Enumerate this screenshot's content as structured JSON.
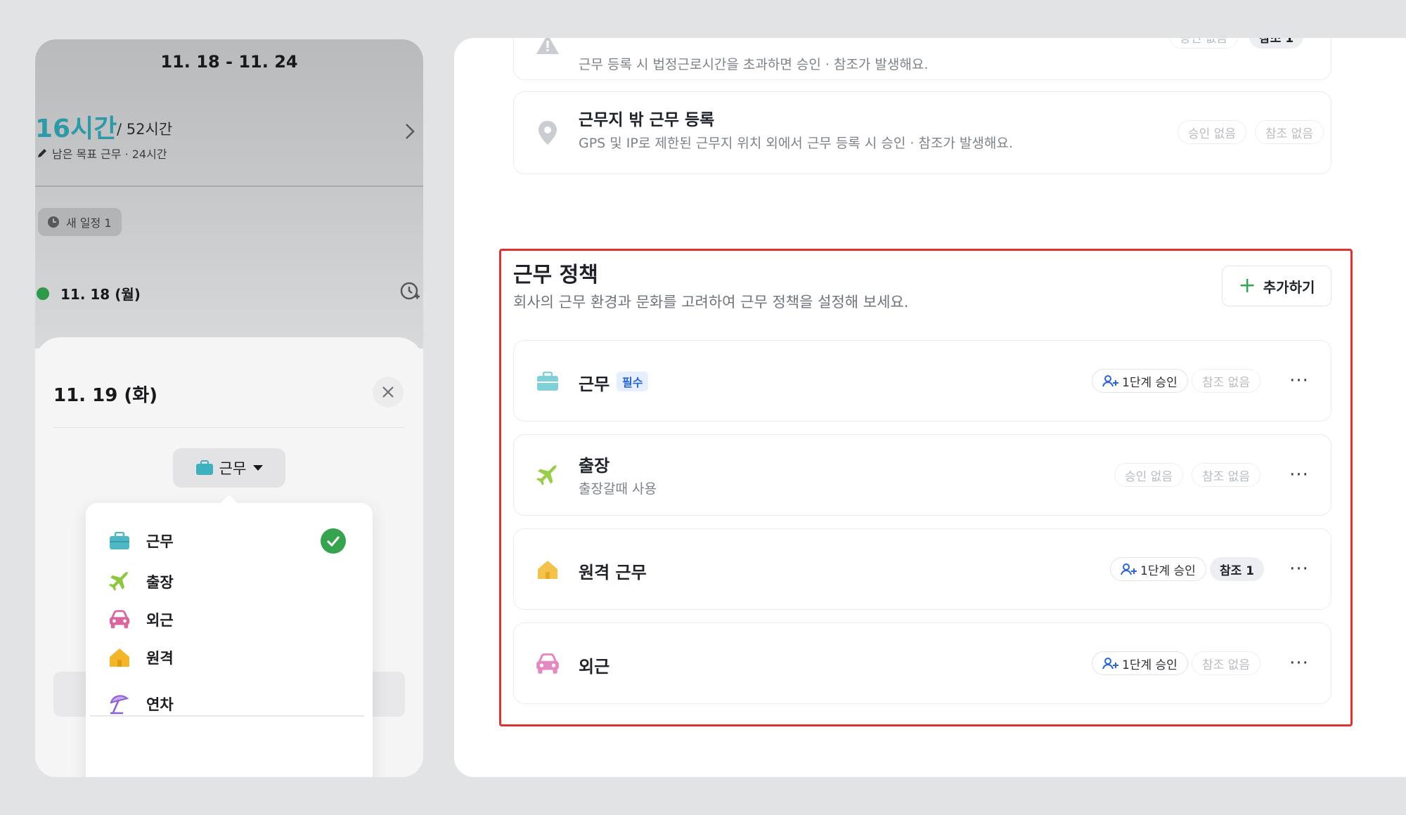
{
  "phone": {
    "week_range": "11. 18 - 11. 24",
    "hours_worked": "16시간",
    "hours_total": "/ 52시간",
    "goal_text": "남은 목표 근무 · 24시간",
    "new_schedule": "새 일정 1",
    "day_label": "11. 18 (월)",
    "sheet": {
      "title": "11. 19 (화)",
      "type_button": "근무",
      "options": [
        {
          "label": "근무",
          "icon": "briefcase-icon",
          "color": "#4fb7c4",
          "selected": true
        },
        {
          "label": "출장",
          "icon": "airplane-icon",
          "color": "#8dc63f"
        },
        {
          "label": "외근",
          "icon": "car-icon",
          "color": "#d9669f"
        },
        {
          "label": "원격",
          "icon": "house-icon",
          "color": "#f2b52c"
        },
        {
          "label": "연차",
          "icon": "umbrella-icon",
          "color": "#8e5ed6"
        }
      ]
    }
  },
  "panel": {
    "top_cards": [
      {
        "desc": "근무 등록 시 법정근로시간을 초과하면 승인 · 참조가 발생해요.",
        "chips": [
          "승인 없음",
          "참조 1"
        ]
      },
      {
        "title": "근무지 밖 근무 등록",
        "desc": "GPS 및 IP로 제한된 근무지 위치 외에서 근무 등록 시 승인 · 참조가 발생해요.",
        "chips": [
          "승인 없음",
          "참조 없음"
        ]
      }
    ],
    "section": {
      "title": "근무 정책",
      "subtitle": "회사의 근무 환경과 문화를 고려하여 근무 정책을 설정해 보세요.",
      "add_button": "추가하기",
      "policies": [
        {
          "name": "근무",
          "badge": "필수",
          "approval": "1단계 승인",
          "reference": "참조 없음",
          "icon": "briefcase-icon",
          "color": "#7fd0d9"
        },
        {
          "name": "출장",
          "sub": "출장갈때 사용",
          "approval": "승인 없음",
          "reference": "참조 없음",
          "icon": "airplane-icon",
          "color": "#9acd4a"
        },
        {
          "name": "원격 근무",
          "approval": "1단계 승인",
          "reference": "참조 1",
          "icon": "house-icon",
          "color": "#f2c24b"
        },
        {
          "name": "외근",
          "approval": "1단계 승인",
          "reference": "참조 없음",
          "icon": "car-icon",
          "color": "#e38bc0"
        }
      ],
      "more": "···"
    }
  },
  "colors": {
    "highlight": "#e0312e",
    "accent_teal": "#2e9aa7",
    "check_green": "#36a34f"
  }
}
